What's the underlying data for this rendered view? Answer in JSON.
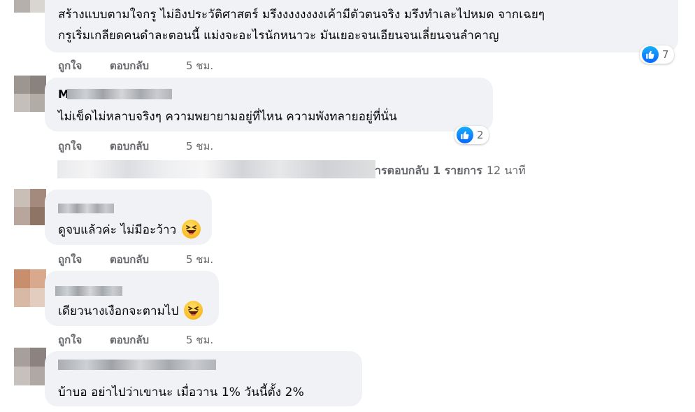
{
  "comments": [
    {
      "id": 1,
      "name_initial": "",
      "lines": [
        "สร้างแบบตามใจกรู ไม่อิงประวัติศาสตร์ มรึงงงงงงงงเค้ามีตัวตนจริง มรึงทำเละไปหมด จากเฉยๆ",
        "กรูเริ่มเกลียดคนดำละตอนนี้ แม่งจะอะไรนักหนาวะ มันเยอะจนเอียนจนเลี่ยนจนลำคาญ"
      ],
      "reaction": {
        "icon": "like-icon",
        "count": "7"
      },
      "like_label": "ถูกใจ",
      "reply_label": "ตอบกลับ",
      "time": "5 ชม."
    },
    {
      "id": 2,
      "name_initial": "M",
      "lines": [
        "ไม่เข็ดไม่หลาบจริงๆ ความพยายามอยู่ที่ไหน ความพังทลายอยู่ที่นั่น"
      ],
      "reaction": {
        "icon": "like-icon",
        "count": "2"
      },
      "like_label": "ถูกใจ",
      "reply_label": "ตอบกลับ",
      "time": "5 ชม."
    },
    {
      "id": 3,
      "name_initial": "",
      "lines": [
        "ดูจบแล้วค่ะ ไม่มีอะว้าว"
      ],
      "emoji": "laughing-emoji-icon",
      "like_label": "ถูกใจ",
      "reply_label": "ตอบกลับ",
      "time": "5 ชม."
    },
    {
      "id": 4,
      "name_initial": "",
      "lines": [
        "เดียวนางเงือกจะตามไป"
      ],
      "emoji": "laughing-emoji-icon",
      "like_label": "ถูกใจ",
      "reply_label": "ตอบกลับ",
      "time": "5 ชม."
    },
    {
      "id": 5,
      "name_initial": "",
      "lines": [
        "บ้าบอ อย่าไปว่าเขานะ เมื่อวาน 1% วันนี้ตั้ง 2%"
      ]
    }
  ],
  "replies_link": {
    "label": "ารตอบกลับ 1 รายการ",
    "time": "12 นาที"
  },
  "colors": {
    "bubble": "#f0f2f5",
    "meta_text": "#65676b",
    "like_blue": "#0866ff"
  }
}
